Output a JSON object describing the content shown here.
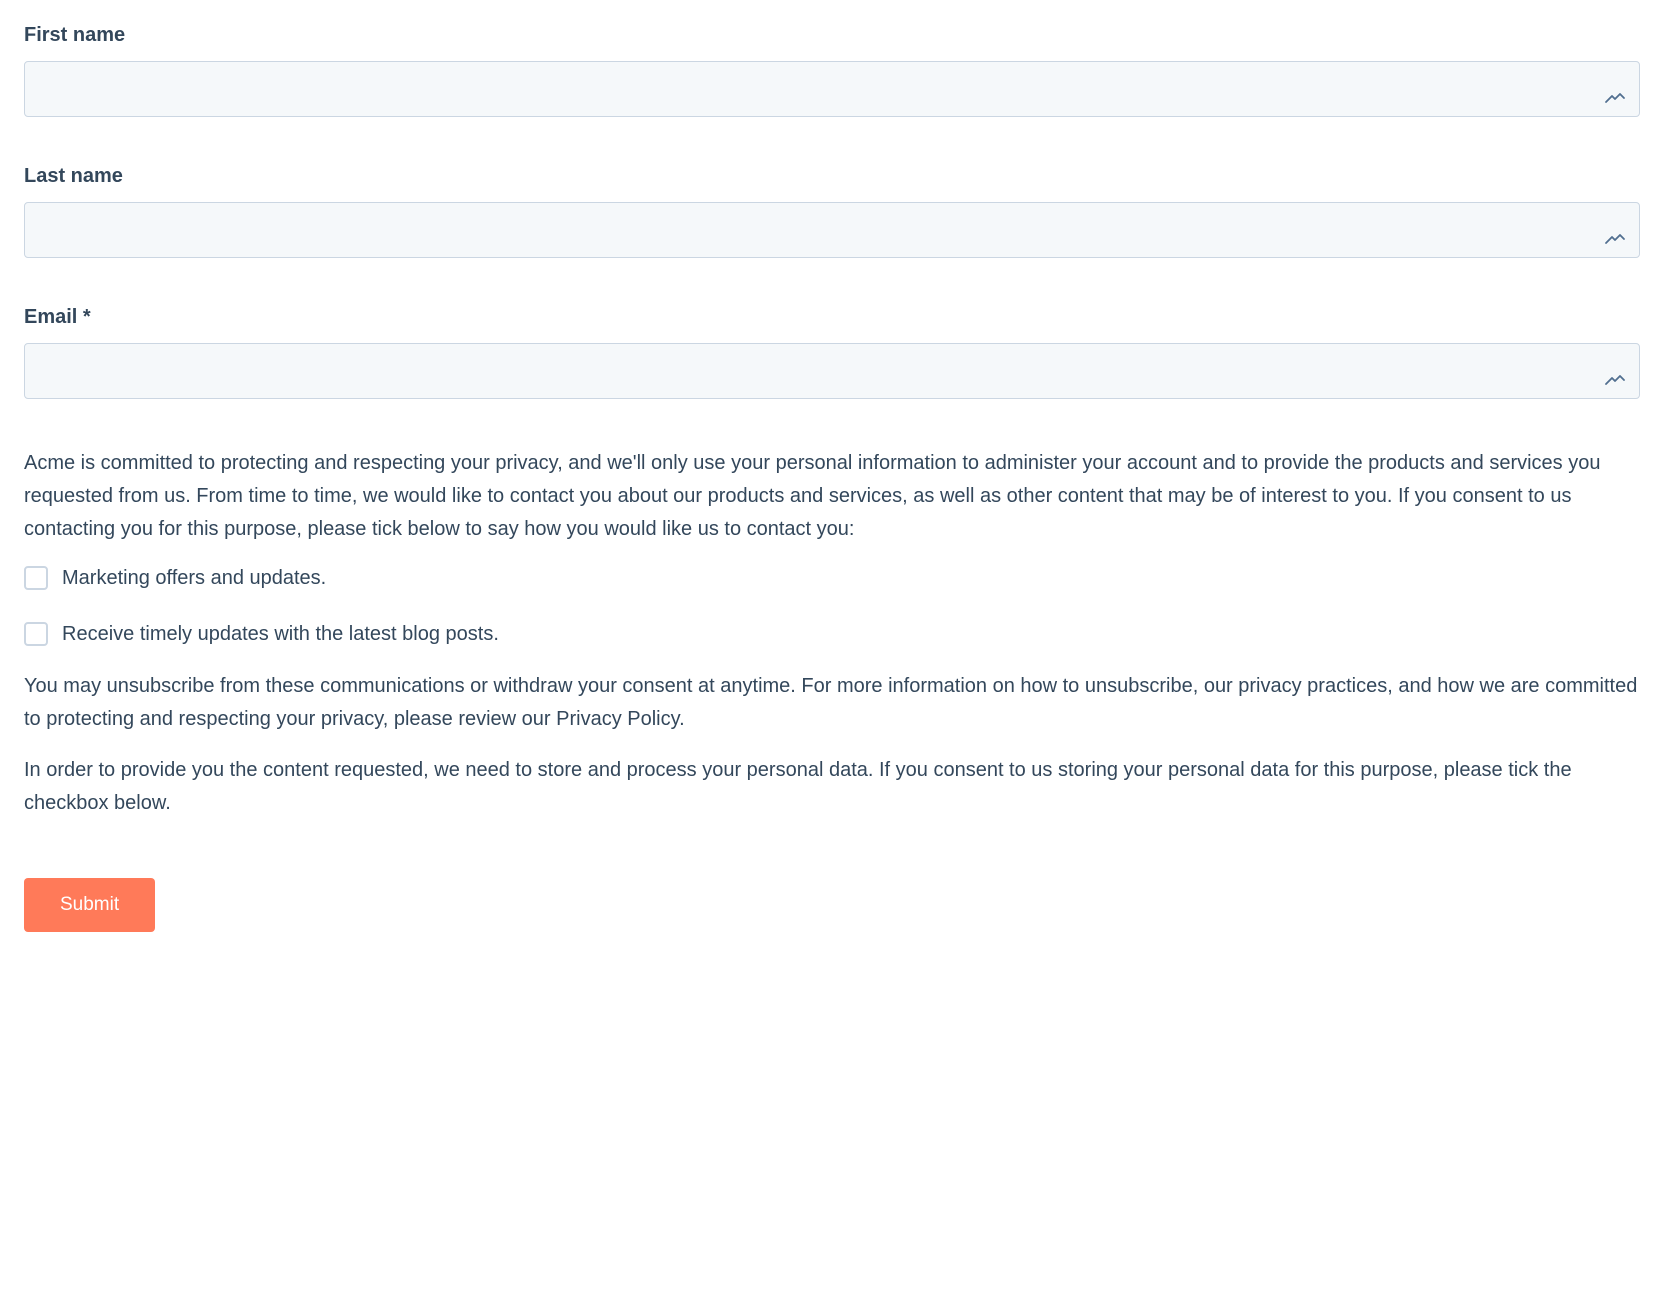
{
  "form": {
    "fields": {
      "first_name": {
        "label": "First name",
        "value": ""
      },
      "last_name": {
        "label": "Last name",
        "value": ""
      },
      "email": {
        "label": "Email *",
        "value": ""
      }
    },
    "privacy": {
      "intro_text": "Acme is committed to protecting and respecting your privacy, and we'll only use your personal information to administer your account and to provide the products and services you requested from us. From time to time, we would like to contact you about our products and services, as well as other content that may be of interest to you. If you consent to us contacting you for this purpose, please tick below to say how you would like us to contact you:",
      "checkboxes": [
        {
          "label": "Marketing offers and updates.",
          "checked": false
        },
        {
          "label": "Receive timely updates with the latest blog posts.",
          "checked": false
        }
      ],
      "unsubscribe_text": "You may unsubscribe from these communications or withdraw your consent at anytime. For more information on how to unsubscribe, our privacy practices, and how we are committed to protecting and respecting your privacy, please review our Privacy Policy.",
      "consent_text": "In order to provide you the content requested, we need to store and process your personal data. If you consent to us storing your personal data for this purpose, please tick the checkbox below."
    },
    "submit_label": "Submit"
  }
}
